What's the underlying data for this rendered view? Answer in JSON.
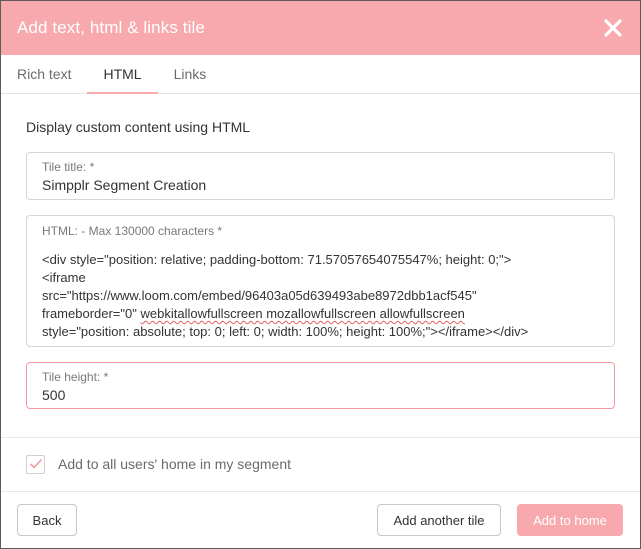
{
  "dialog": {
    "title": "Add text, html & links tile",
    "close_icon": "close-icon"
  },
  "tabs": [
    {
      "label": "Rich text",
      "active": false
    },
    {
      "label": "HTML",
      "active": true
    },
    {
      "label": "Links",
      "active": false
    }
  ],
  "body": {
    "description": "Display custom content using HTML",
    "tile_title": {
      "label": "Tile title: *",
      "value": "Simpplr Segment Creation"
    },
    "html": {
      "label": "HTML: - Max 130000 characters *",
      "line1": "<div style=\"position: relative; padding-bottom: 71.57057654075547%; height: 0;\">",
      "line2": "<iframe",
      "line3": "src=\"https://www.loom.com/embed/96403a05d639493abe8972dbb1acf545\"",
      "line4_a": "frameborder=\"0\"",
      "line4_b": "webkitallowfullscreen mozallowfullscreen allowfullscreen",
      "line5": "style=\"position: absolute; top: 0; left: 0; width: 100%; height: 100%;\"></iframe></div>"
    },
    "tile_height": {
      "label": "Tile height: *",
      "value": "500"
    }
  },
  "add_to_home": {
    "label": "Add to all users' home in my segment",
    "checked": true
  },
  "footer": {
    "back_label": "Back",
    "add_another_label": "Add another tile",
    "add_home_label": "Add to home"
  },
  "colors": {
    "accent": "#f7a9ad",
    "error_border": "#f29aa0"
  }
}
